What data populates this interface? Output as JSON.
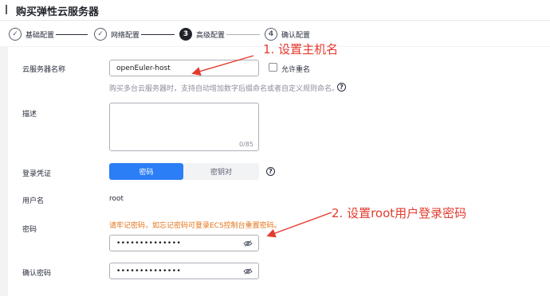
{
  "header": {
    "title": "购买弹性云服务器"
  },
  "steps": [
    {
      "number": "✓",
      "label": "基础配置",
      "state": "done"
    },
    {
      "number": "✓",
      "label": "网络配置",
      "state": "done"
    },
    {
      "number": "3",
      "label": "高级配置",
      "state": "active"
    },
    {
      "number": "4",
      "label": "确认配置",
      "state": "pending"
    }
  ],
  "form": {
    "server_name": {
      "label": "云服务器名称",
      "value": "openEuler-host",
      "allow_duplicate_label": "允许重名",
      "hint": "购买多台云服务器时，支持自动增加数字后缀命名或者自定义规则命名。"
    },
    "description": {
      "label": "描述",
      "counter": "0/85"
    },
    "credential": {
      "label": "登录凭证",
      "options": [
        "密码",
        "密钥对"
      ],
      "selected": "密码"
    },
    "username": {
      "label": "用户名",
      "value": "root"
    },
    "password": {
      "label": "密码",
      "warning": "请牢记密码，如忘记密码可登录ECS控制台重置密码。",
      "masked_value": "••••••••••••••"
    },
    "confirm_password": {
      "label": "确认密码",
      "masked_value": "••••••••••••••"
    }
  },
  "annotations": {
    "step1": "1. 设置主机名",
    "step2": "2. 设置root用户登录密码"
  },
  "colors": {
    "accent": "#2b7ef5",
    "annotation": "#e53a2e",
    "warning": "#e37318"
  }
}
